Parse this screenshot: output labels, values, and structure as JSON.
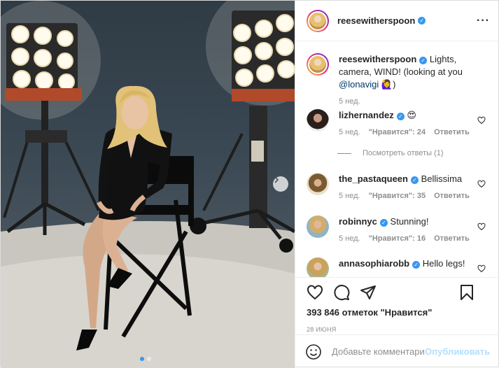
{
  "post": {
    "author": "reesewitherspoon",
    "verified_mark": "✓",
    "more_icon": "more-horizontal-icon",
    "carousel": {
      "total_slides": 2,
      "current_slide": 1
    }
  },
  "caption": {
    "author": "reesewitherspoon",
    "text": "Lights, camera, WIND! (looking at you ",
    "mention": "@lonavigi",
    "emoji": "🙋‍♀️",
    "suffix": ")",
    "time": "5 нед."
  },
  "comments": [
    {
      "user": "lizhernandez",
      "text": "😍",
      "time": "5 нед.",
      "likes": "\"Нравится\": 24",
      "reply": "Ответить",
      "view_replies": "Посмотреть ответы (1)"
    },
    {
      "user": "the_pastaqueen",
      "text": "Bellissima",
      "time": "5 нед.",
      "likes": "\"Нравится\": 35",
      "reply": "Ответить"
    },
    {
      "user": "robinnyc",
      "text": "Stunning!",
      "time": "5 нед.",
      "likes": "\"Нравится\": 16",
      "reply": "Ответить"
    },
    {
      "user": "annasophiarobb",
      "text": "Hello legs!"
    }
  ],
  "likes_count": "393 846 отметок \"Нравится\"",
  "date": "28 ИЮНЯ",
  "composer": {
    "placeholder": "Добавьте комментарий...",
    "publish": "Опубликовать"
  },
  "colors": {
    "link": "#00376b",
    "accent": "#3897f0",
    "muted": "#8e8e8e",
    "publish_disabled": "#b2dffc"
  }
}
